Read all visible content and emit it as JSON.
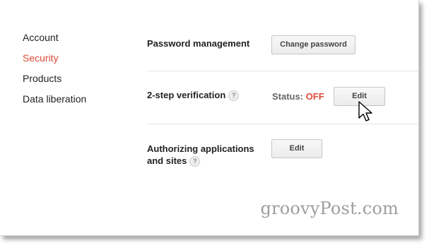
{
  "sidebar": {
    "items": [
      {
        "label": "Account"
      },
      {
        "label": "Security"
      },
      {
        "label": "Products"
      },
      {
        "label": "Data liberation"
      }
    ],
    "active_color": "#dd4b39"
  },
  "password": {
    "label": "Password management",
    "button_label": "Change password"
  },
  "two_step": {
    "label": "2-step verification",
    "help": "?",
    "status_label": "Status:",
    "status_value": "OFF",
    "button_label": "Edit"
  },
  "authorizing": {
    "label_line1": "Authorizing applications",
    "label_line2": "and sites",
    "help": "?",
    "button_label": "Edit"
  },
  "watermark": "groovyPost.com",
  "cursor_icon": "arrow-cursor-icon"
}
